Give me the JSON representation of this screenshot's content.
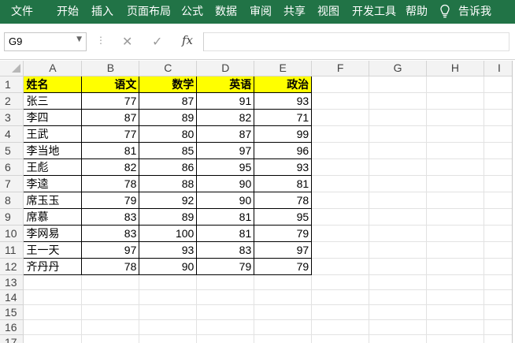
{
  "ribbon": {
    "tabs": [
      "文件",
      "开始",
      "插入",
      "页面布局",
      "公式",
      "数据",
      "审阅",
      "共享",
      "视图",
      "开发工具",
      "帮助"
    ],
    "tell_me": "告诉我",
    "bg_color": "#217346"
  },
  "formula_bar": {
    "name_box": "G9",
    "cancel_icon": "✕",
    "enter_icon": "✓",
    "fx_label": "fx",
    "formula": ""
  },
  "sheet": {
    "columns": [
      "A",
      "B",
      "C",
      "D",
      "E",
      "F",
      "G",
      "H",
      "I"
    ],
    "row_numbers": [
      "1",
      "2",
      "3",
      "4",
      "5",
      "6",
      "7",
      "8",
      "9",
      "10",
      "11",
      "12",
      "13",
      "14",
      "15",
      "16",
      "17"
    ],
    "header_fill": "#ffff00",
    "headers": [
      "姓名",
      "语文",
      "数学",
      "英语",
      "政治"
    ],
    "rows": [
      [
        "张三",
        "77",
        "87",
        "91",
        "93"
      ],
      [
        "李四",
        "87",
        "89",
        "82",
        "71"
      ],
      [
        "王武",
        "77",
        "80",
        "87",
        "99"
      ],
      [
        "李当地",
        "81",
        "85",
        "97",
        "96"
      ],
      [
        "王彪",
        "82",
        "86",
        "95",
        "93"
      ],
      [
        "李逵",
        "78",
        "88",
        "90",
        "81"
      ],
      [
        "席玉玉",
        "79",
        "92",
        "90",
        "78"
      ],
      [
        "席慕",
        "83",
        "89",
        "81",
        "95"
      ],
      [
        "李网易",
        "83",
        "100",
        "81",
        "79"
      ],
      [
        "王一天",
        "97",
        "93",
        "83",
        "97"
      ],
      [
        "齐丹丹",
        "78",
        "90",
        "79",
        "79"
      ]
    ]
  }
}
